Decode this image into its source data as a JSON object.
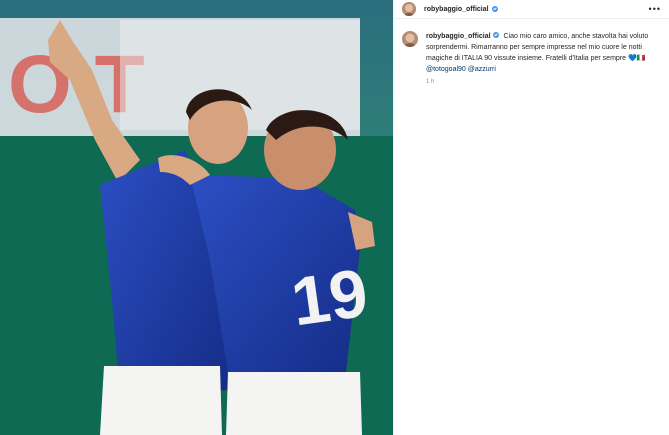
{
  "post": {
    "account": {
      "username": "robybaggio_official",
      "verified": true
    },
    "header": {
      "more_label": "•••"
    },
    "caption": {
      "username": "robybaggio_official",
      "text": "Ciao mio caro amico, anche stavolta hai voluto sorprendermi. Rimarranno per sempre impresse nel mio cuore le notti magiche di ITALIA 90 vissute insieme. Fratelli d'Italia per sempre",
      "emoji": "💙",
      "suffix": "🇮🇹",
      "mentions": [
        "@totogoal90",
        "@azzurri"
      ],
      "timestamp": "1 h"
    },
    "photo": {
      "jersey_number": "19"
    }
  },
  "colors": {
    "pitch": "#0b6e5b",
    "jersey": "#1f3ea8",
    "verified": "#3897f0",
    "mention": "#00376b",
    "timestamp": "#8e8e8e"
  }
}
